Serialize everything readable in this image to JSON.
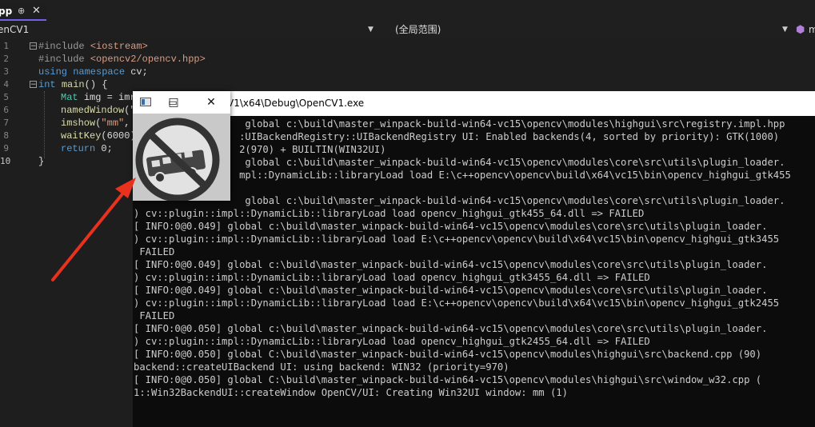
{
  "tab": {
    "title": "pp",
    "pin": "⊕",
    "close": "✕"
  },
  "nav": {
    "project": "enCV1",
    "scope": "(全局范围)",
    "member": "m"
  },
  "editor": {
    "line_numbers": [
      "1",
      "2",
      "3",
      "4",
      "5",
      "6",
      "7",
      "8",
      "9",
      "10"
    ],
    "lines": [
      {
        "parts": [
          {
            "t": "#include ",
            "c": "pp"
          },
          {
            "t": "<iostream>",
            "c": "str"
          }
        ]
      },
      {
        "parts": [
          {
            "t": "#include ",
            "c": "pp"
          },
          {
            "t": "<opencv2/opencv.hpp>",
            "c": "str"
          }
        ]
      },
      {
        "parts": [
          {
            "t": "using namespace ",
            "c": "kw"
          },
          {
            "t": "cv;",
            "c": ""
          }
        ]
      },
      {
        "parts": [
          {
            "t": "int ",
            "c": "kw"
          },
          {
            "t": "main",
            "c": "fn"
          },
          {
            "t": "() {",
            "c": ""
          }
        ]
      },
      {
        "parts": [
          {
            "t": "Mat ",
            "c": "ty"
          },
          {
            "t": "img = imr",
            "c": ""
          }
        ]
      },
      {
        "parts": [
          {
            "t": "namedWindow",
            "c": "fn"
          },
          {
            "t": "(\"",
            "c": ""
          }
        ]
      },
      {
        "parts": [
          {
            "t": "imshow",
            "c": "fn"
          },
          {
            "t": "(",
            "c": ""
          },
          {
            "t": "\"mm\"",
            "c": "str"
          },
          {
            "t": ",",
            "c": ""
          }
        ]
      },
      {
        "parts": [
          {
            "t": "waitKey",
            "c": "fn"
          },
          {
            "t": "(6000)",
            "c": ""
          }
        ]
      },
      {
        "parts": [
          {
            "t": "return ",
            "c": "kw"
          },
          {
            "t": "0;",
            "c": ""
          }
        ]
      },
      {
        "parts": [
          {
            "t": "}",
            "c": ""
          }
        ]
      }
    ]
  },
  "console": {
    "title": "V1\\x64\\Debug\\OpenCV1.exe",
    "lines": [
      "                   global c:\\build\\master_winpack-build-win64-vc15\\opencv\\modules\\highgui\\src\\registry.impl.hpp",
      "                  :UIBackendRegistry::UIBackendRegistry UI: Enabled backends(4, sorted by priority): GTK(1000)",
      "                  2(970) + BUILTIN(WIN32UI)",
      "                   global c:\\build\\master_winpack-build-win64-vc15\\opencv\\modules\\core\\src\\utils\\plugin_loader.",
      "                  mpl::DynamicLib::libraryLoad load E:\\c++opencv\\opencv\\build\\x64\\vc15\\bin\\opencv_highgui_gtk455",
      "",
      "                   global c:\\build\\master_winpack-build-win64-vc15\\opencv\\modules\\core\\src\\utils\\plugin_loader.",
      ") cv::plugin::impl::DynamicLib::libraryLoad load opencv_highgui_gtk455_64.dll => FAILED",
      "[ INFO:0@0.049] global c:\\build\\master_winpack-build-win64-vc15\\opencv\\modules\\core\\src\\utils\\plugin_loader.",
      ") cv::plugin::impl::DynamicLib::libraryLoad load E:\\c++opencv\\opencv\\build\\x64\\vc15\\bin\\opencv_highgui_gtk3455",
      " FAILED",
      "[ INFO:0@0.049] global c:\\build\\master_winpack-build-win64-vc15\\opencv\\modules\\core\\src\\utils\\plugin_loader.",
      ") cv::plugin::impl::DynamicLib::libraryLoad load opencv_highgui_gtk3455_64.dll => FAILED",
      "[ INFO:0@0.049] global c:\\build\\master_winpack-build-win64-vc15\\opencv\\modules\\core\\src\\utils\\plugin_loader.",
      ") cv::plugin::impl::DynamicLib::libraryLoad load E:\\c++opencv\\opencv\\build\\x64\\vc15\\bin\\opencv_highgui_gtk2455",
      " FAILED",
      "[ INFO:0@0.050] global c:\\build\\master_winpack-build-win64-vc15\\opencv\\modules\\core\\src\\utils\\plugin_loader.",
      ") cv::plugin::impl::DynamicLib::libraryLoad load opencv_highgui_gtk2455_64.dll => FAILED",
      "[ INFO:0@0.050] global C:\\build\\master_winpack-build-win64-vc15\\opencv\\modules\\highgui\\src\\backend.cpp (90)",
      "backend::createUIBackend UI: using backend: WIN32 (priority=970)",
      "[ INFO:0@0.050] global C:\\build\\master_winpack-build-win64-vc15\\opencv\\modules\\highgui\\src\\window_w32.cpp (",
      "1::Win32BackendUI::createWindow OpenCV/UI: Creating Win32UI window: mm (1)"
    ]
  },
  "image_window": {
    "minimize": "☐",
    "maximize": "□",
    "close": "✕"
  },
  "colors": {
    "accent": "#7160e8",
    "arrow": "#e8321e"
  }
}
